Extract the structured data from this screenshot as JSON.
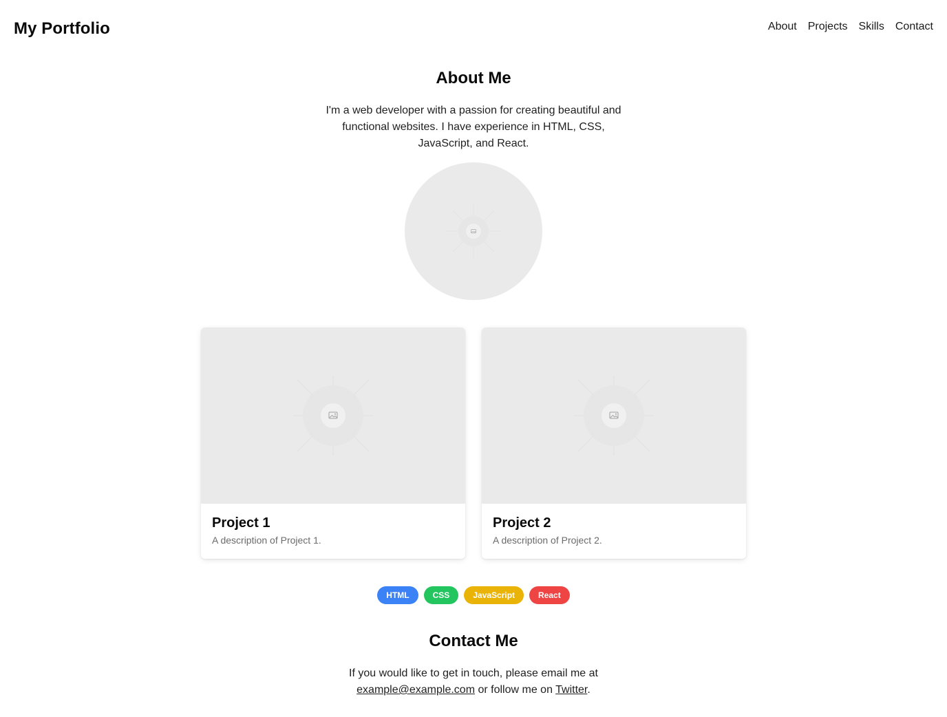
{
  "header": {
    "brand": "My Portfolio",
    "nav": [
      "About",
      "Projects",
      "Skills",
      "Contact"
    ]
  },
  "about": {
    "title": "About Me",
    "text": "I'm a web developer with a passion for creating beautiful and functional websites. I have experience in HTML, CSS, JavaScript, and React.",
    "avatar_icon": "image-placeholder-icon"
  },
  "projects": [
    {
      "title": "Project 1",
      "description": "A description of Project 1.",
      "image_icon": "image-placeholder-icon"
    },
    {
      "title": "Project 2",
      "description": "A description of Project 2.",
      "image_icon": "image-placeholder-icon"
    }
  ],
  "skills": [
    {
      "label": "HTML",
      "color": "#3b82f6"
    },
    {
      "label": "CSS",
      "color": "#22c55e"
    },
    {
      "label": "JavaScript",
      "color": "#eab308"
    },
    {
      "label": "React",
      "color": "#ef4444"
    }
  ],
  "contact": {
    "title": "Contact Me",
    "text_before": "If you would like to get in touch, please email me at",
    "email": "example@example.com",
    "text_middle": "or follow me on",
    "twitter": "Twitter",
    "text_after": "."
  }
}
